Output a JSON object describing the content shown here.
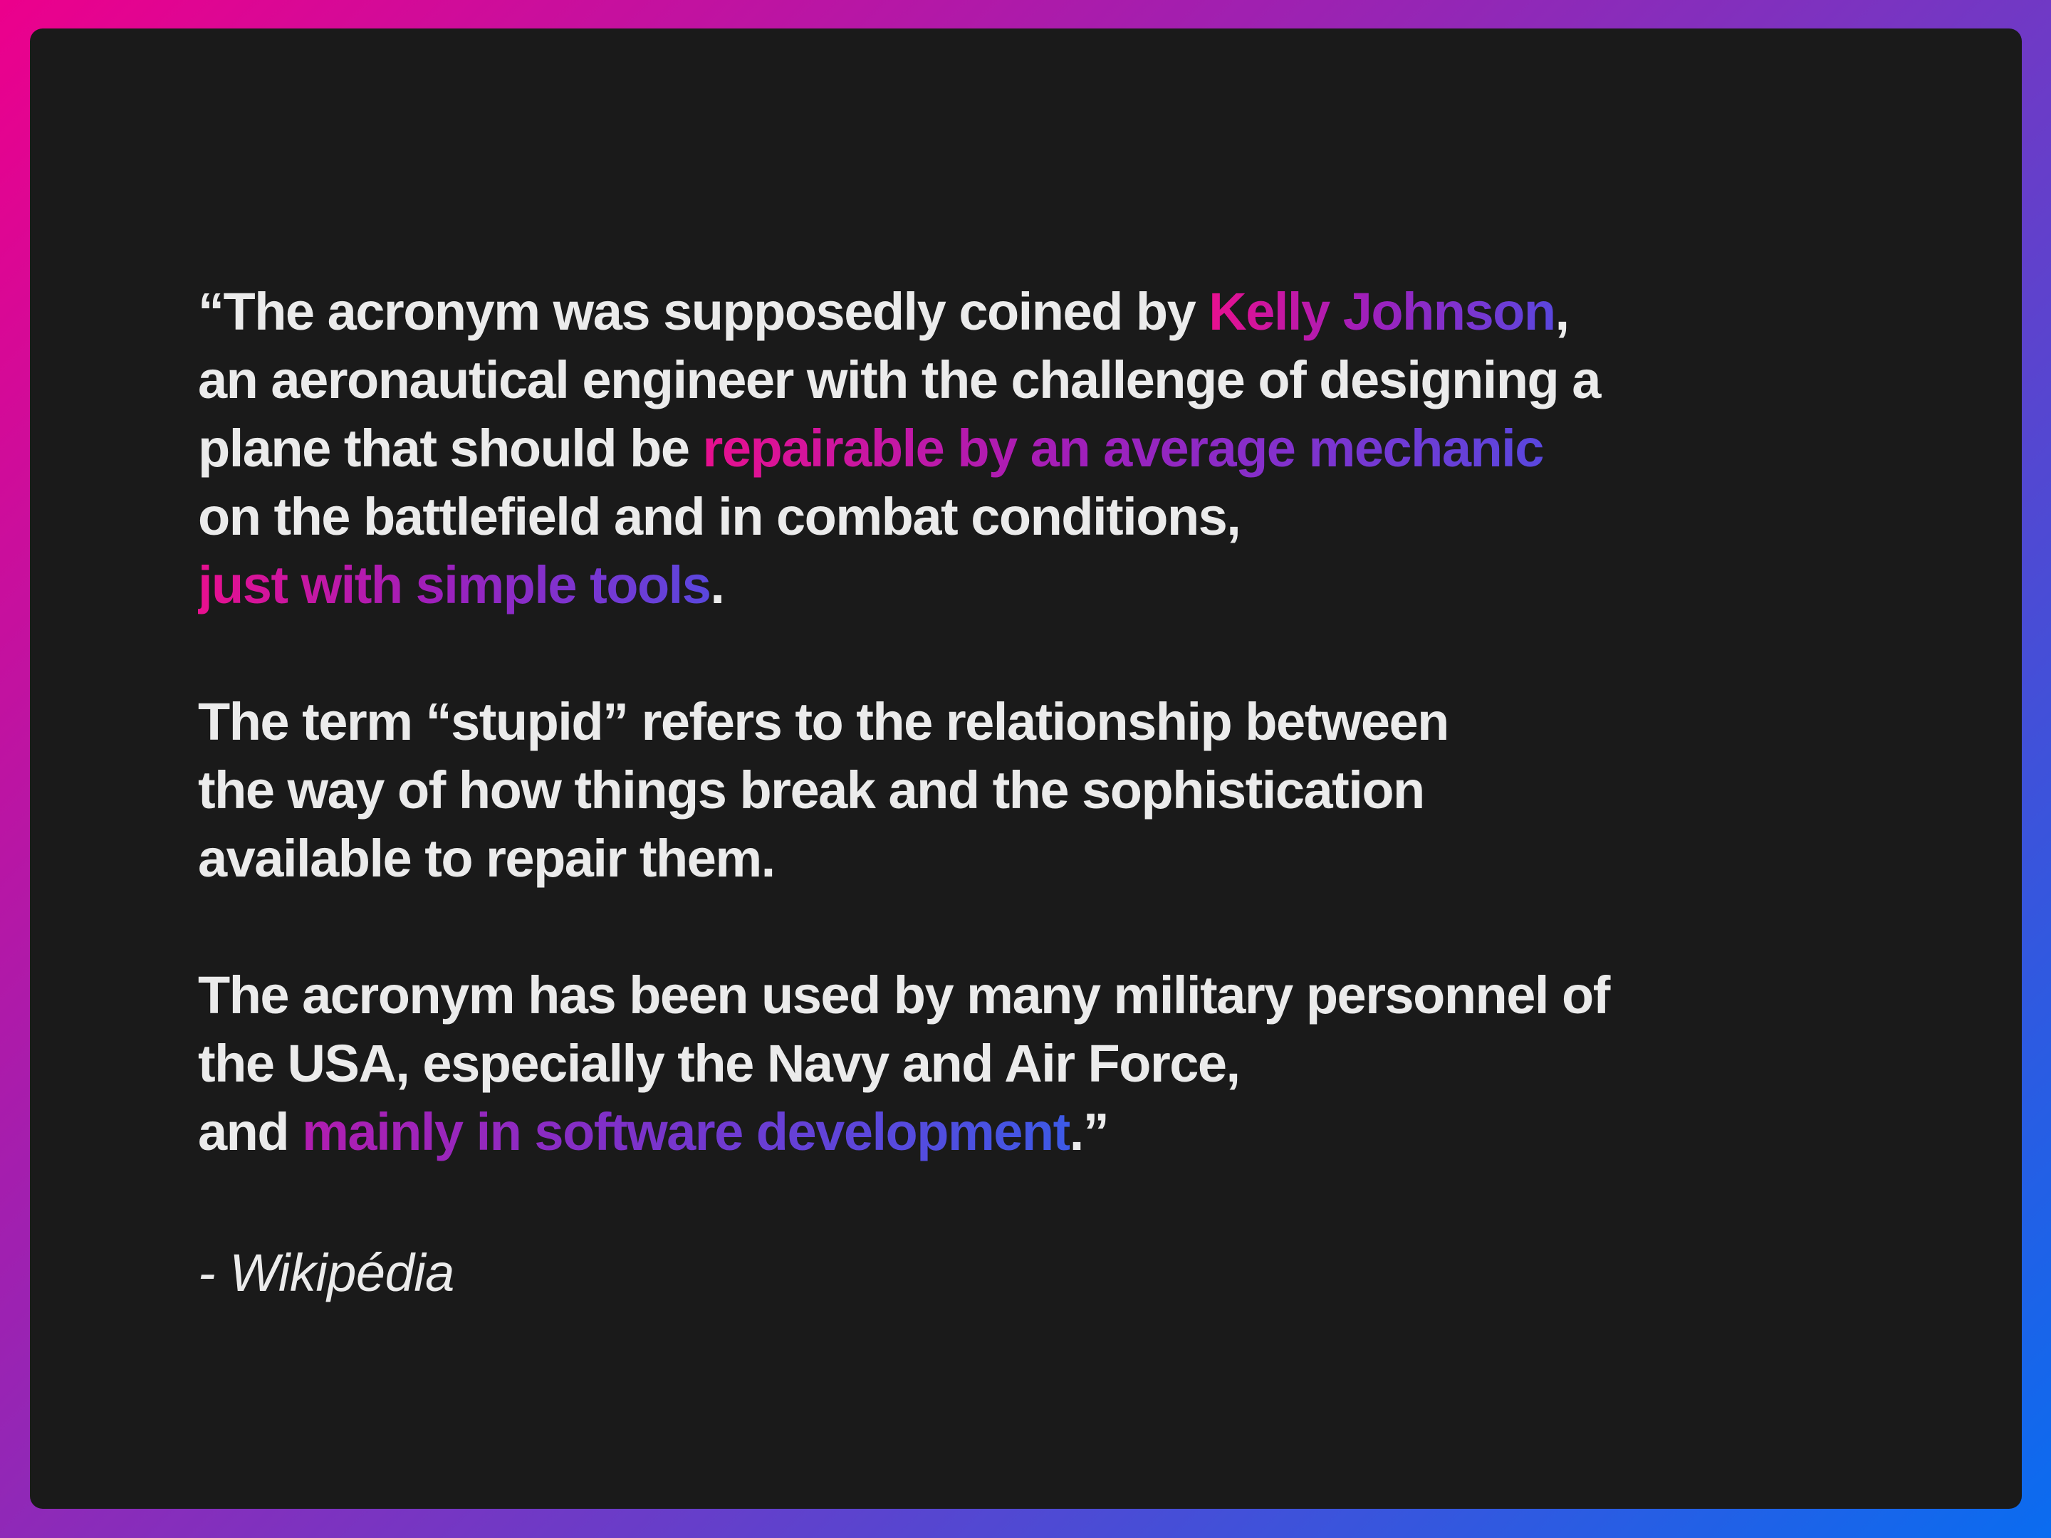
{
  "colors": {
    "background_start": "#ec008c",
    "background_end": "#0a6cf0",
    "card": "#1a1a1a",
    "text": "#ebebeb"
  },
  "quote": {
    "p1": {
      "l1_a": "“The acronym was supposedly coined by ",
      "l1_hl": "Kelly Johnson",
      "l1_b": ",",
      "l2": "an aeronautical engineer with the challenge of designing a",
      "l3_a": "plane that should be ",
      "l3_hl": "repairable by an average mechanic",
      "l4": "on the battlefield and in combat conditions,",
      "l5_hl": "just with simple tools",
      "l5_b": "."
    },
    "p2": {
      "l1": "The term “stupid” refers to the relationship between",
      "l2": "the way of how things break and the sophistication",
      "l3": "available to repair them."
    },
    "p3": {
      "l1": "The acronym has been used by many military personnel of",
      "l2": "the USA, especially the Navy and Air Force,",
      "l3_a": "and ",
      "l3_hl": "mainly in software development",
      "l3_b": ".”"
    }
  },
  "source": "- Wikipédia"
}
